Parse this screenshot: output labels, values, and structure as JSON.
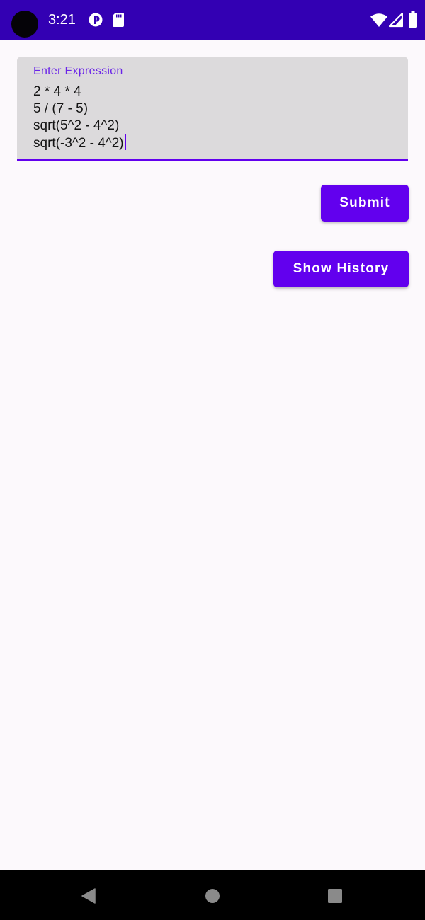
{
  "status_bar": {
    "time": "3:21",
    "background": "#3300b3",
    "left_icons": [
      "notification-badge-icon",
      "sd-card-icon"
    ],
    "right_icons": [
      "wifi-icon",
      "cellular-signal-icon",
      "battery-icon"
    ]
  },
  "expression_field": {
    "label": "Enter Expression",
    "lines": [
      "2 * 4 * 4",
      "5 / (7 - 5)",
      "sqrt(5^2 - 4^2)",
      "sqrt(-3^2 - 4^2)"
    ],
    "accent": "#6200ee"
  },
  "buttons": {
    "submit_label": "Submit",
    "show_history_label": "Show History",
    "color": "#6200ee"
  },
  "nav_bar": {
    "icons": [
      "back-icon",
      "home-icon",
      "recents-icon"
    ]
  }
}
